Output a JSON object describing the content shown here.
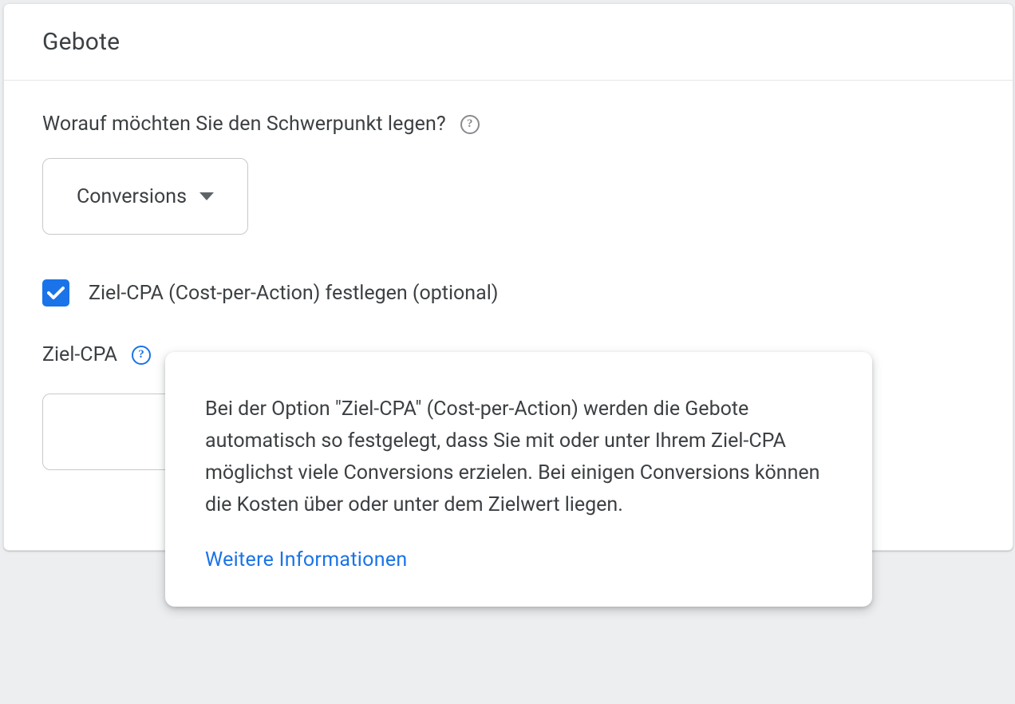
{
  "card": {
    "title": "Gebote"
  },
  "focus": {
    "question": "Worauf möchten Sie den Schwerpunkt legen?",
    "selected": "Conversions"
  },
  "target_cpa": {
    "checkbox_label": "Ziel-CPA (Cost-per-Action) festlegen (optional)",
    "checked": true,
    "label": "Ziel-CPA",
    "value": ""
  },
  "tooltip": {
    "body": "Bei der Option \"Ziel-CPA\" (Cost-per-Action) werden die Gebote automatisch so festgelegt, dass Sie mit oder unter Ihrem Ziel-CPA möglichst viele Conversions erzielen. Bei einigen Conversions können die Kosten über oder unter dem Zielwert liegen.",
    "link": "Weitere Informationen"
  },
  "icons": {
    "help": "?"
  }
}
